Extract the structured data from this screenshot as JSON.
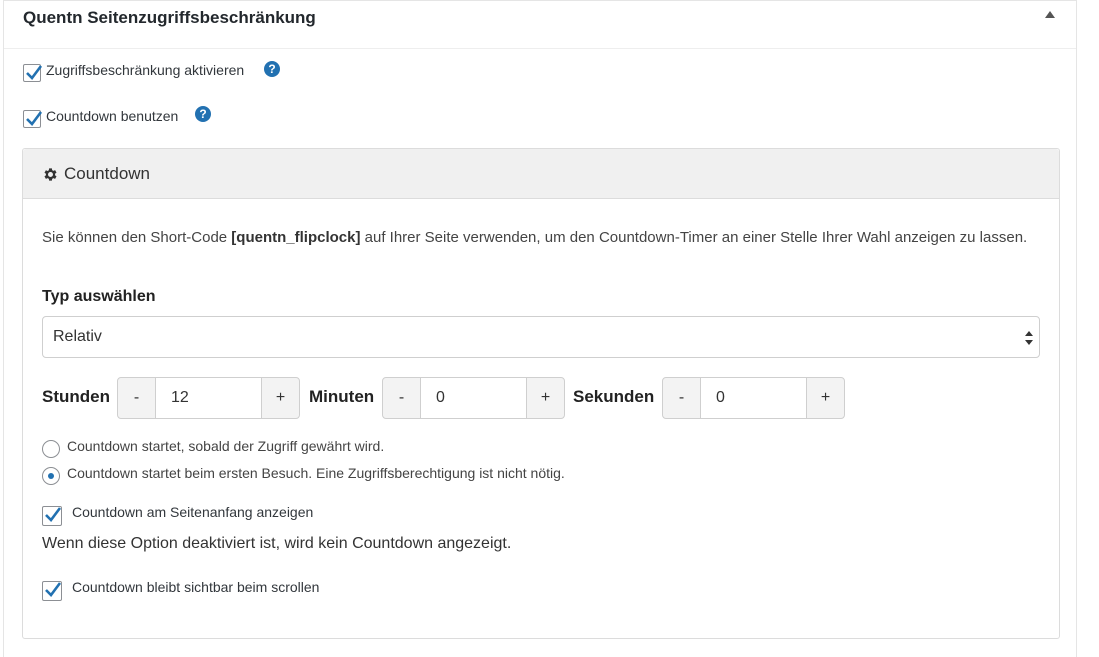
{
  "metabox": {
    "title": "Quentn Seitenzugriffsbeschränkung"
  },
  "options": {
    "restrict_access": {
      "label": "Zugriffsbeschränkung aktivieren",
      "checked": true,
      "help_glyph": "?"
    },
    "use_countdown": {
      "label": "Countdown benutzen",
      "checked": true,
      "help_glyph": "?"
    }
  },
  "countdown_panel": {
    "title": "Countdown",
    "desc_prefix": "Sie können den Short-Code ",
    "desc_shortcode": "[quentn_flipclock]",
    "desc_suffix": " auf Ihrer Seite verwenden, um den Countdown-Timer an einer Stelle Ihrer Wahl anzeigen zu lassen.",
    "type_label": "Typ auswählen",
    "type_value": "Relativ",
    "hours": {
      "label": "Stunden",
      "value": "12",
      "minus": "-",
      "plus": "+"
    },
    "minutes": {
      "label": "Minuten",
      "value": "0",
      "minus": "-",
      "plus": "+"
    },
    "seconds": {
      "label": "Sekunden",
      "value": "0",
      "minus": "-",
      "plus": "+"
    },
    "radio_options": [
      {
        "label": "Countdown startet, sobald der Zugriff gewährt wird.",
        "selected": false
      },
      {
        "label": "Countdown startet beim ersten Besuch. Eine Zugriffsberechtigung ist nicht nötig.",
        "selected": true
      }
    ],
    "show_top": {
      "label": "Countdown am Seitenanfang anzeigen",
      "checked": true
    },
    "show_top_hint": "Wenn diese Option deaktiviert ist, wird kein Countdown angezeigt.",
    "sticky": {
      "label": "Countdown bleibt sichtbar beim scrollen",
      "checked": true
    }
  },
  "colors": {
    "accent": "#2271b1",
    "heading_bg": "#f0f0f0"
  },
  "icons": {
    "gear": "gear-icon",
    "help": "question-circle-icon",
    "arrow": "chevron-up-icon",
    "check": "checkmark-icon"
  }
}
